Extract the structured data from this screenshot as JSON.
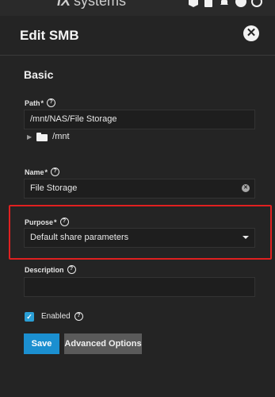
{
  "topbar": {
    "brand_logo": "iX",
    "brand_text": "systems",
    "icons": [
      "cube-icon",
      "clipboard-icon",
      "bell-icon",
      "account-icon",
      "power-icon"
    ]
  },
  "dialog": {
    "title": "Edit SMB",
    "section": "Basic",
    "path": {
      "label": "Path",
      "required": "*",
      "value": "/mnt/NAS/File Storage",
      "tree_item": "/mnt"
    },
    "name": {
      "label": "Name",
      "required": "*",
      "value": "File Storage"
    },
    "purpose": {
      "label": "Purpose",
      "required": "*",
      "selected": "Default share parameters"
    },
    "description": {
      "label": "Description",
      "value": ""
    },
    "enabled": {
      "label": "Enabled",
      "checked": true
    },
    "buttons": {
      "save": "Save",
      "advanced": "Advanced Options"
    }
  },
  "colors": {
    "accent": "#1b8fd0",
    "checkbox": "#2a9fd6",
    "highlight": "#e02020"
  }
}
